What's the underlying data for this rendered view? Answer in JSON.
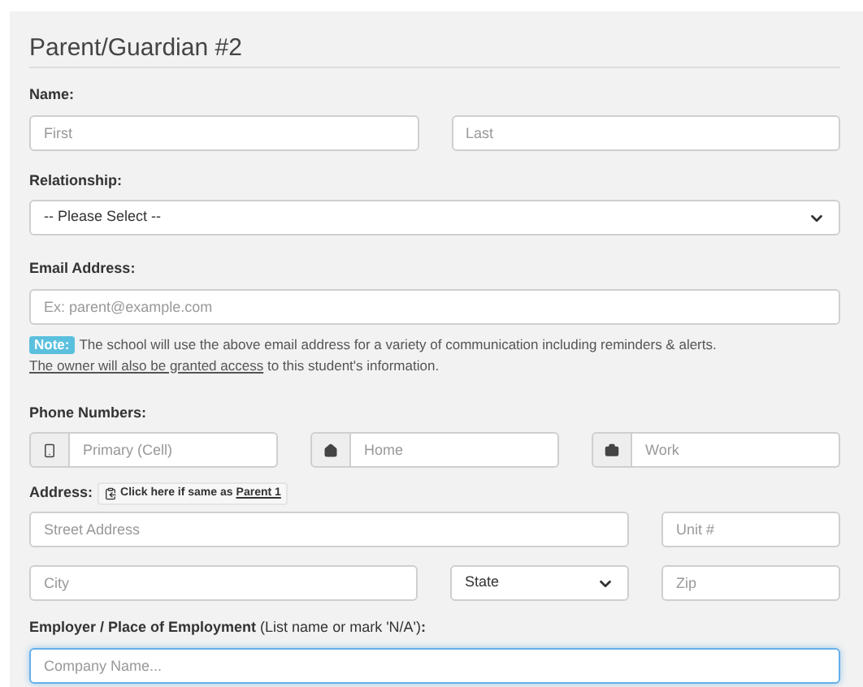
{
  "title": "Parent/Guardian #2",
  "name": {
    "label": "Name:",
    "fields": [
      {
        "placeholder": "First"
      },
      {
        "placeholder": "Last"
      }
    ]
  },
  "relationship": {
    "label": "Relationship:",
    "value": "-- Please Select --"
  },
  "email": {
    "label": "Email Address:",
    "placeholder": "Ex: parent@example.com"
  },
  "note": {
    "badge": "Note:",
    "text": "The school will use the above email address for a variety of communication including reminders & alerts.",
    "link": "The owner will also be granted access",
    "after": "to this student's information."
  },
  "phones": {
    "label": "Phone Numbers:",
    "fields": [
      {
        "kind": "mobile",
        "placeholder": "Primary (Cell)"
      },
      {
        "kind": "home",
        "placeholder": "Home"
      },
      {
        "kind": "work",
        "placeholder": "Work"
      }
    ]
  },
  "address": {
    "label": "Address:",
    "copy_button": "Click here if same as",
    "copy_link": "Parent 1",
    "street": {
      "placeholder": "Street Address"
    },
    "unit": {
      "placeholder": "Unit #"
    },
    "city": {
      "placeholder": "City"
    },
    "state": "State",
    "zip": {
      "placeholder": "Zip"
    }
  },
  "employer": {
    "label": "**Employer / Place of Employment** (List name or mark 'N/A')**:**",
    "placeholder": "Company Name...",
    "focused": true
  }
}
